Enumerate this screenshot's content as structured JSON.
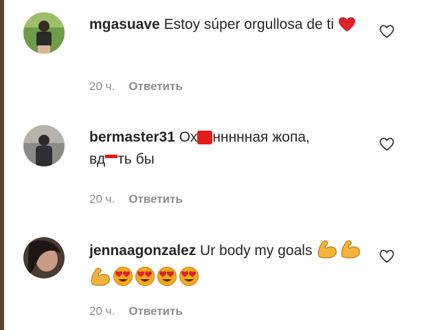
{
  "comments": [
    {
      "username": "mgasuave",
      "text": "Estoy súper orgullosa de ti",
      "emoji_icons": [
        "red-heart-emoji"
      ],
      "time": "20 ч.",
      "reply_label": "Ответить"
    },
    {
      "username": "bermaster31",
      "text_part1": "Ох",
      "text_part2": "ннннная жопа,",
      "text_part3": "вд",
      "text_part4": "ть бы",
      "time": "20 ч.",
      "reply_label": "Ответить"
    },
    {
      "username": "jennaagonzalez",
      "text": "Ur body my goals",
      "emoji_icons": [
        "flexed-biceps-emoji",
        "flexed-biceps-emoji",
        "flexed-biceps-emoji",
        "heart-eyes-emoji",
        "heart-eyes-emoji",
        "heart-eyes-emoji",
        "heart-eyes-emoji"
      ],
      "time": "20 ч.",
      "reply_label": "Ответить"
    }
  ],
  "colors": {
    "text": "#262626",
    "meta": "#8e8e8e",
    "heart_emoji": "#e0202a",
    "biceps": "#f5b33c",
    "face": "#f7a81d",
    "redaction": "#e21b1b"
  }
}
